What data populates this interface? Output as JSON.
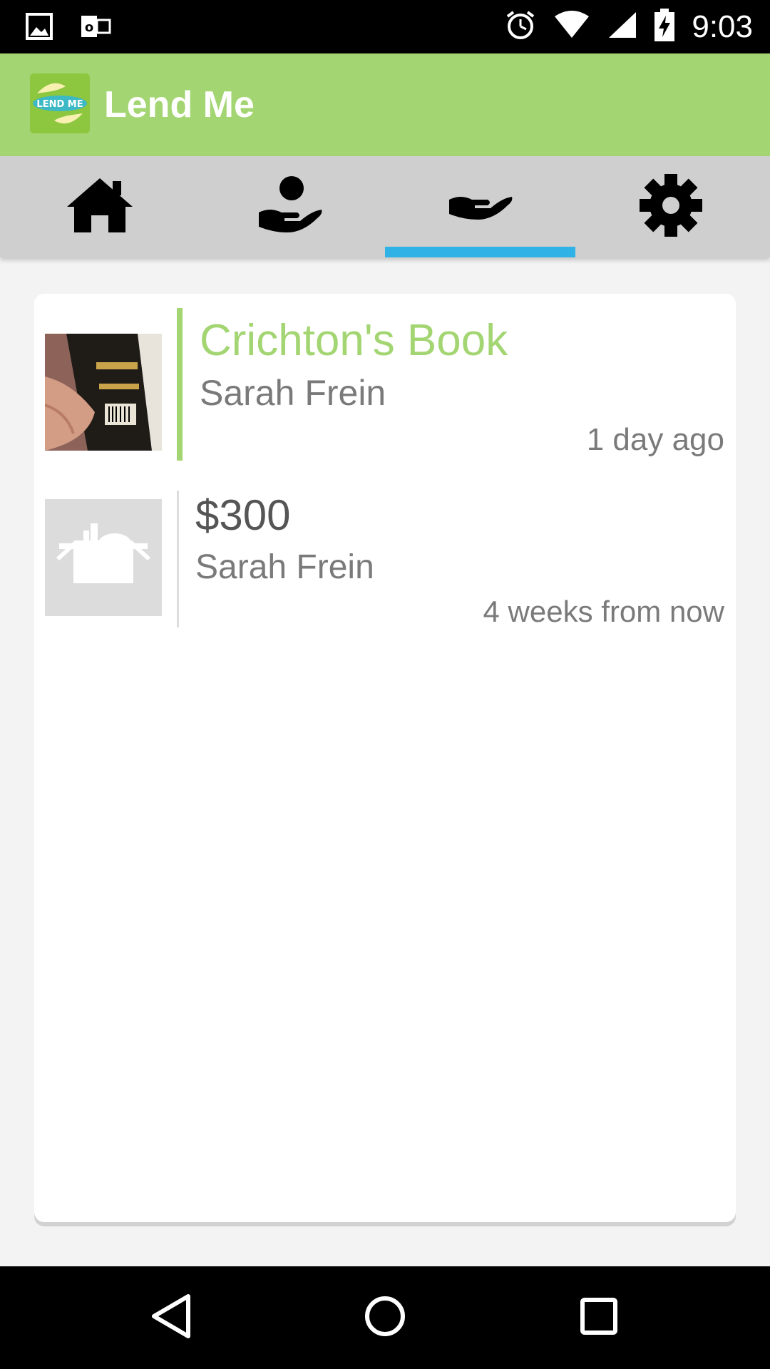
{
  "status_bar": {
    "time": "9:03",
    "icons": [
      "image-icon",
      "outlook-icon",
      "alarm-icon",
      "wifi-icon",
      "signal-icon",
      "battery-icon"
    ]
  },
  "app_bar": {
    "title": "Lend Me",
    "logo_text": "LEND ME",
    "color": "#a3d572"
  },
  "tabs": [
    {
      "icon": "home-icon",
      "selected": false
    },
    {
      "icon": "lend-icon",
      "selected": false
    },
    {
      "icon": "borrow-icon",
      "selected": true
    },
    {
      "icon": "gear-icon",
      "selected": false
    }
  ],
  "accent": "#2fb2e5",
  "items": [
    {
      "title": "Crichton's Book",
      "person": "Sarah Frein",
      "time": "1 day ago",
      "title_color": "#a3d572",
      "image": "book-photo"
    },
    {
      "title": "$300",
      "person": "Sarah Frein",
      "time": "4 weeks from now",
      "title_color": "#555555",
      "image": "placeholder-box-icon"
    }
  ],
  "nav_bar": {
    "buttons": [
      "back-icon",
      "home-circle-icon",
      "recents-icon"
    ]
  }
}
